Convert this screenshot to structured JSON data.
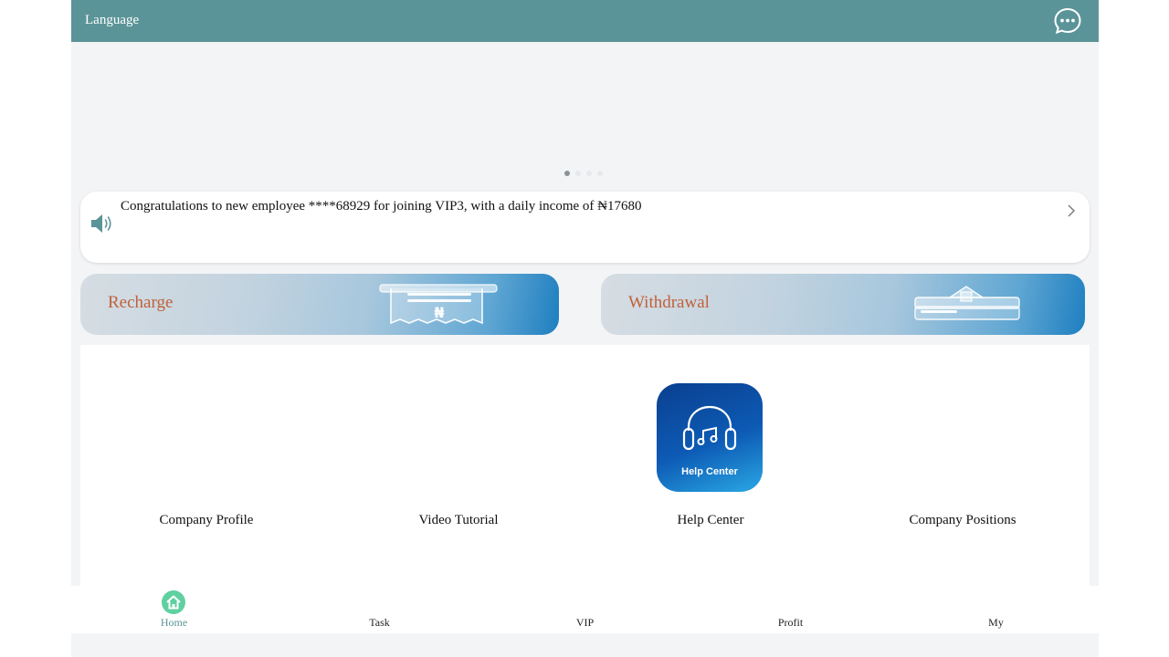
{
  "header": {
    "language_label": "Language",
    "chat_icon": "chat-bubble-icon",
    "background_color": "#5b9498"
  },
  "banner": {
    "slide_count": 4,
    "active_slide": 1
  },
  "notice": {
    "icon": "speaker-icon",
    "message": "Congratulations to new employee ****68929 for joining VIP3, with a daily income of ₦17680",
    "chevron_icon": "chevron-right-icon"
  },
  "actions": {
    "recharge_label": "Recharge",
    "withdrawal_label": "Withdrawal",
    "label_color": "#c0613a"
  },
  "shortcuts": [
    {
      "label": "Company Profile"
    },
    {
      "label": "Video Tutorial"
    },
    {
      "label": "Help Center",
      "icon_text": "Help Center",
      "icon": "headphones-icon"
    },
    {
      "label": "Company Positions"
    }
  ],
  "tabbar": {
    "active_color": "#5b9498",
    "tabs": [
      {
        "label": "Home",
        "icon": "home-icon",
        "active": true
      },
      {
        "label": "Task"
      },
      {
        "label": "VIP"
      },
      {
        "label": "Profit"
      },
      {
        "label": "My"
      }
    ]
  }
}
